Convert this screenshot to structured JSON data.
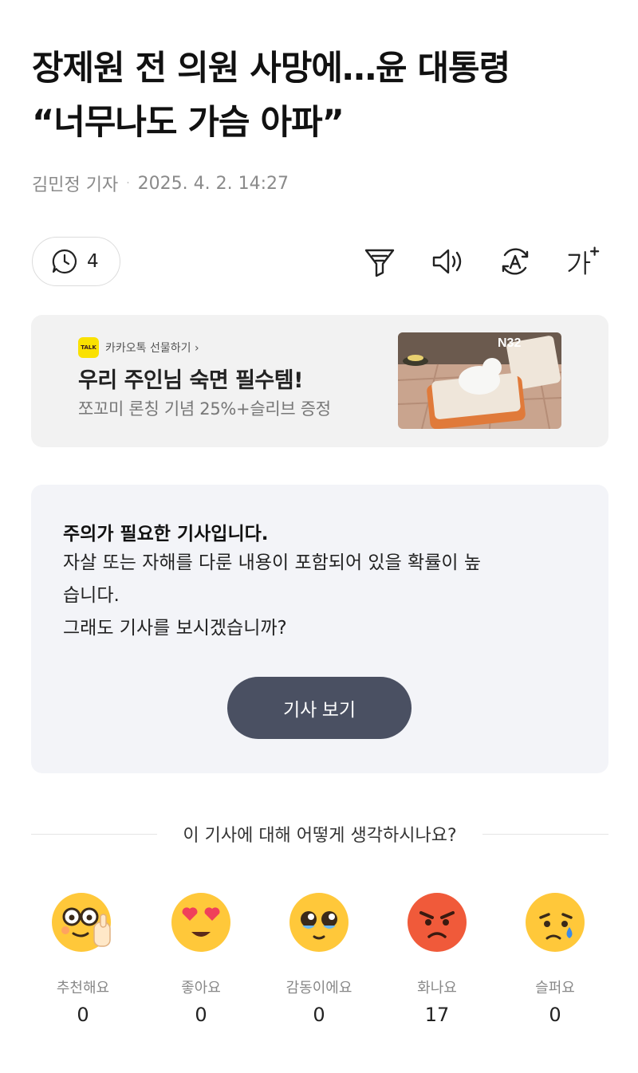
{
  "article": {
    "title_line1": "장제원 전 의원 사망에…윤 대통령",
    "title_line2": "“너무나도 가슴 아파”",
    "author": "김민정 기자",
    "separator": "·",
    "datetime": "2025. 4. 2. 14:27"
  },
  "toolbar": {
    "comment_count": "4",
    "icons": [
      "comment-clock-icon",
      "summary-filter-icon",
      "speaker-icon",
      "translate-icon",
      "font-size-icon"
    ],
    "font_size_label": "가+"
  },
  "ad": {
    "brand": "카카오톡 선물하기 ›",
    "talk_badge": "TALK",
    "headline": "우리 주인님 숙면 필수템!",
    "subtext": "쪼꼬미 론칭 기념 25%+슬리브 증정",
    "thumb_logo": "N32"
  },
  "warning": {
    "title": "주의가 필요한 기사입니다.",
    "line1": "자살 또는 자해를 다룬 내용이 포함되어 있을 확률이 높",
    "line2": "습니다.",
    "line3": "그래도 기사를 보시겠습니까?",
    "button": "기사 보기"
  },
  "reactions": {
    "prompt": "이 기사에 대해 어떻게 생각하시나요?",
    "items": [
      {
        "label": "추천해요",
        "count": "0",
        "icon": "recommend-emoji-icon"
      },
      {
        "label": "좋아요",
        "count": "0",
        "icon": "heart-eyes-emoji-icon"
      },
      {
        "label": "감동이에요",
        "count": "0",
        "icon": "touched-emoji-icon"
      },
      {
        "label": "화나요",
        "count": "17",
        "icon": "angry-emoji-icon"
      },
      {
        "label": "슬퍼요",
        "count": "0",
        "icon": "sad-emoji-icon"
      }
    ]
  },
  "colors": {
    "button_bg": "#4a5062",
    "angry": "#f05a3a",
    "emoji_yellow": "#ffc83a",
    "kakao_yellow": "#fae100"
  }
}
